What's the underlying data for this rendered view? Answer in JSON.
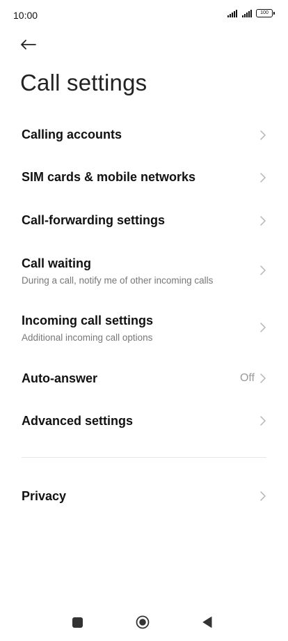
{
  "status_bar": {
    "time": "10:00",
    "battery": "100"
  },
  "header": {
    "back_icon": "arrow-left-icon",
    "title": "Call settings"
  },
  "items": [
    {
      "title": "Calling accounts",
      "subtitle": "",
      "value": ""
    },
    {
      "title": "SIM cards & mobile networks",
      "subtitle": "",
      "value": ""
    },
    {
      "title": "Call-forwarding settings",
      "subtitle": "",
      "value": ""
    },
    {
      "title": "Call waiting",
      "subtitle": "During a call, notify me of other incoming calls",
      "value": ""
    },
    {
      "title": "Incoming call settings",
      "subtitle": "Additional incoming call options",
      "value": ""
    },
    {
      "title": "Auto-answer",
      "subtitle": "",
      "value": "Off"
    },
    {
      "title": "Advanced settings",
      "subtitle": "",
      "value": ""
    },
    {
      "title": "Privacy",
      "subtitle": "",
      "value": ""
    }
  ],
  "nav": {
    "recents_icon": "square-icon",
    "home_icon": "circle-icon",
    "back_icon": "triangle-back-icon"
  },
  "colors": {
    "title": "#222222",
    "item_title": "#111111",
    "subtitle": "#777777",
    "chevron": "#b5b5b5",
    "value": "#9a9a9a",
    "divider": "#e6e6e6"
  }
}
